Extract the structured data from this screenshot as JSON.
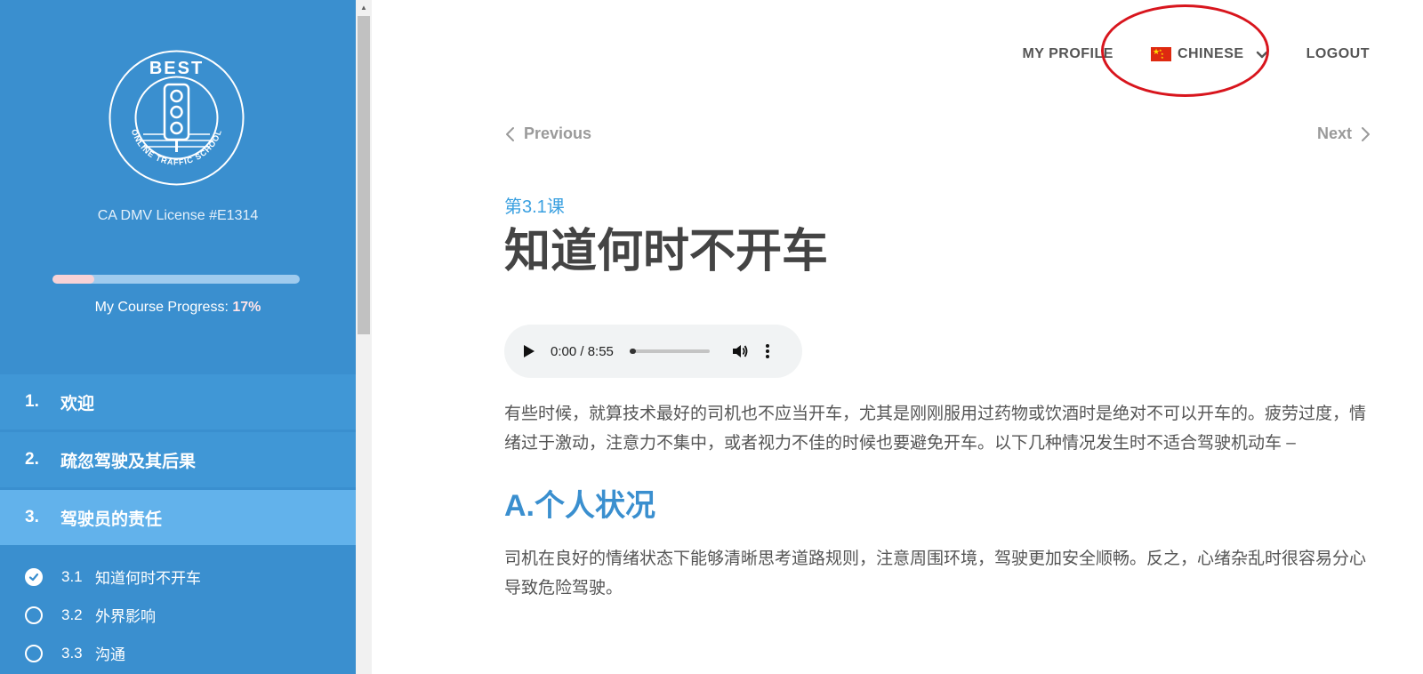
{
  "sidebar": {
    "logo": {
      "top_text": "BEST",
      "ring_text": "ONLINE TRAFFIC SCHOOL"
    },
    "license": "CA DMV License #E1314",
    "progress": {
      "label": "My Course Progress:",
      "value_text": "17%",
      "fraction": 0.17
    },
    "chapters": [
      {
        "num": "1.",
        "title": "欢迎",
        "active": false
      },
      {
        "num": "2.",
        "title": "疏忽驾驶及其后果",
        "active": false
      },
      {
        "num": "3.",
        "title": "驾驶员的责任",
        "active": true
      }
    ],
    "lessons": [
      {
        "num": "3.1",
        "title": "知道何时不开车",
        "completed": true
      },
      {
        "num": "3.2",
        "title": "外界影响",
        "completed": false
      },
      {
        "num": "3.3",
        "title": "沟通",
        "completed": false
      }
    ]
  },
  "nav": {
    "profile": "MY PROFILE",
    "language": "CHINESE",
    "logout": "LOGOUT"
  },
  "pager": {
    "previous": "Previous",
    "next": "Next"
  },
  "lesson": {
    "label": "第3.1课",
    "title": "知道何时不开车",
    "audio_time": "0:00 / 8:55",
    "para1": "有些时候，就算技术最好的司机也不应当开车，尤其是刚刚服用过药物或饮酒时是绝对不可以开车的。疲劳过度，情绪过于激动，注意力不集中，或者视力不佳的时候也要避免开车。以下几种情况发生时不适合驾驶机动车 –",
    "section_heading": "A.个人状况",
    "para2": "司机在良好的情绪状态下能够清晰思考道路规则，注意周围环境，驾驶更加安全顺畅。反之，心绪杂乱时很容易分心导致危险驾驶。"
  },
  "colors": {
    "sidebar": "#3a8fcf",
    "accent": "#3aa0e0",
    "annotation": "#d8151d"
  }
}
